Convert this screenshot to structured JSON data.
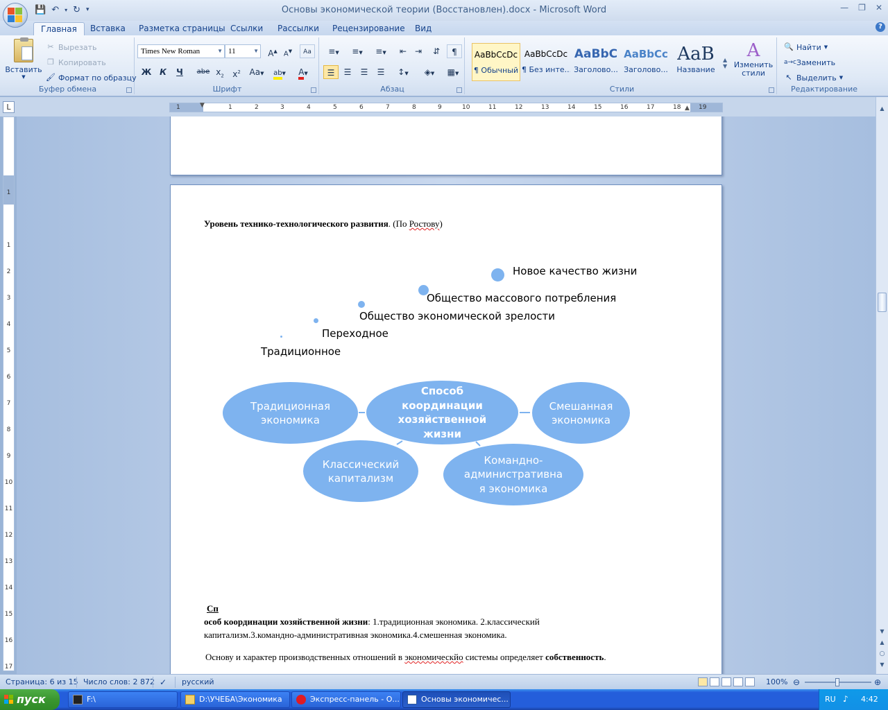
{
  "window": {
    "title": "Основы экономической теории (Восстановлен).docx",
    "title_app": " - Microsoft Word"
  },
  "tabs": [
    "Главная",
    "Вставка",
    "Разметка страницы",
    "Ссылки",
    "Рассылки",
    "Рецензирование",
    "Вид"
  ],
  "ribbon": {
    "clipboard": {
      "paste": "Вставить",
      "cut": "Вырезать",
      "copy": "Копировать",
      "format_painter": "Формат по образцу",
      "label": "Буфер обмена"
    },
    "font": {
      "name": "Times New Roman",
      "size": "11",
      "bold": "Ж",
      "italic": "К",
      "underline": "Ч",
      "strike": "abe",
      "label": "Шрифт"
    },
    "paragraph": {
      "label": "Абзац"
    },
    "styles": {
      "items": [
        {
          "sample": "AaBbCcDc",
          "name": "¶ Обычный"
        },
        {
          "sample": "AaBbCcDc",
          "name": "¶ Без инте..."
        },
        {
          "sample": "AaBbC",
          "name": "Заголово..."
        },
        {
          "sample": "AaBbCc",
          "name": "Заголово..."
        },
        {
          "sample": "AaB",
          "name": "Название"
        }
      ],
      "change": "Изменить стили",
      "label": "Стили"
    },
    "editing": {
      "find": "Найти",
      "replace": "Заменить",
      "select": "Выделить",
      "label": "Редактирование"
    }
  },
  "ruler": {
    "h_numbers": [
      "1",
      "1",
      "2",
      "3",
      "4",
      "5",
      "6",
      "7",
      "8",
      "9",
      "10",
      "11",
      "12",
      "13",
      "14",
      "15",
      "16",
      "17",
      "18",
      "19"
    ],
    "v_numbers": [
      "1",
      "1",
      "2",
      "3",
      "4",
      "5",
      "6",
      "7",
      "8",
      "9",
      "10",
      "11",
      "12",
      "13",
      "14",
      "15",
      "16",
      "17"
    ]
  },
  "document": {
    "heading_bold": "Уровень технико-технологического развития",
    "heading_rest": ". (По ",
    "heading_link": "Ростову",
    "heading_end": ")",
    "stages": [
      "Новое качество жизни",
      "Общество массового потребления",
      "Общество экономической зрелости",
      "Переходное",
      "Традиционное"
    ],
    "diagram": {
      "center": "Способ координации хозяйственной жизни",
      "left": "Традиционная экономика",
      "right": "Смешанная экономика",
      "bottom_left": "Классический капитализм",
      "bottom_right": "Командно-административна я экономика"
    },
    "para1_sp": "Сп",
    "para1_bold": "особ координации хозяйственной жизни",
    "para1_rest": ": 1.традиционная экономика. 2.классический",
    "para1_line2": "капитализм.3.командно-административная экономика.4.смешенная экономика.",
    "para2_start": "Основу и характер производственных отношений в ",
    "para2_err": "экономическйо",
    "para2_mid": " системы определяет ",
    "para2_bold": "собственность",
    "para2_end": "."
  },
  "status": {
    "page": "Страница: 6 из 15",
    "words": "Число слов: 2 872",
    "language": "русский",
    "zoom": "100%"
  },
  "taskbar": {
    "start": "пуск",
    "items": [
      "F:\\",
      "D:\\УЧЕБА\\Экономика",
      "Экспресс-панель - О...",
      "Основы экономичес..."
    ],
    "lang": "RU",
    "time": "4:42"
  },
  "colors": {
    "diagram_fill": "#7eb3ef",
    "accent": "#15428b",
    "start_green": "#3a962f"
  }
}
